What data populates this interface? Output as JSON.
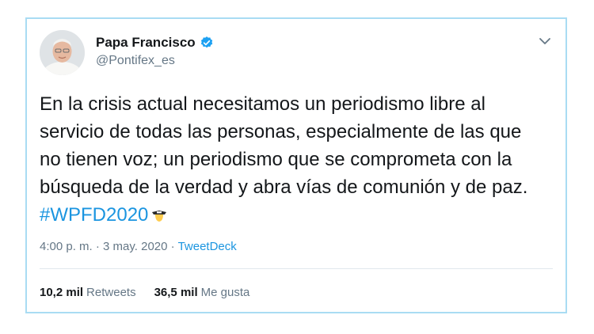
{
  "tweet": {
    "display_name": "Papa Francisco",
    "handle": "@Pontifex_es",
    "text": "En la crisis actual necesitamos un periodismo libre al servicio de todas las personas, especialmente de las que no tienen voz; un periodismo que se comprometa con la búsqueda de la verdad y abra vías de comunión y de paz.",
    "hashtag": "#WPFD2020",
    "time": "4:00 p. m.",
    "date": "3 may. 2020",
    "separator": "·",
    "source": "TweetDeck",
    "retweets_count": "10,2 mil",
    "retweets_label": "Retweets",
    "likes_count": "36,5 mil",
    "likes_label": "Me gusta"
  },
  "icons": {
    "avatar": "avatar-photo",
    "verified": "verified-badge-icon",
    "menu": "chevron-down-icon",
    "hashtag_emoji": "press-hat-emoji"
  },
  "colors": {
    "accent": "#1b95e0",
    "border": "#a9dcf3",
    "text": "#14171a",
    "muted": "#657786"
  }
}
